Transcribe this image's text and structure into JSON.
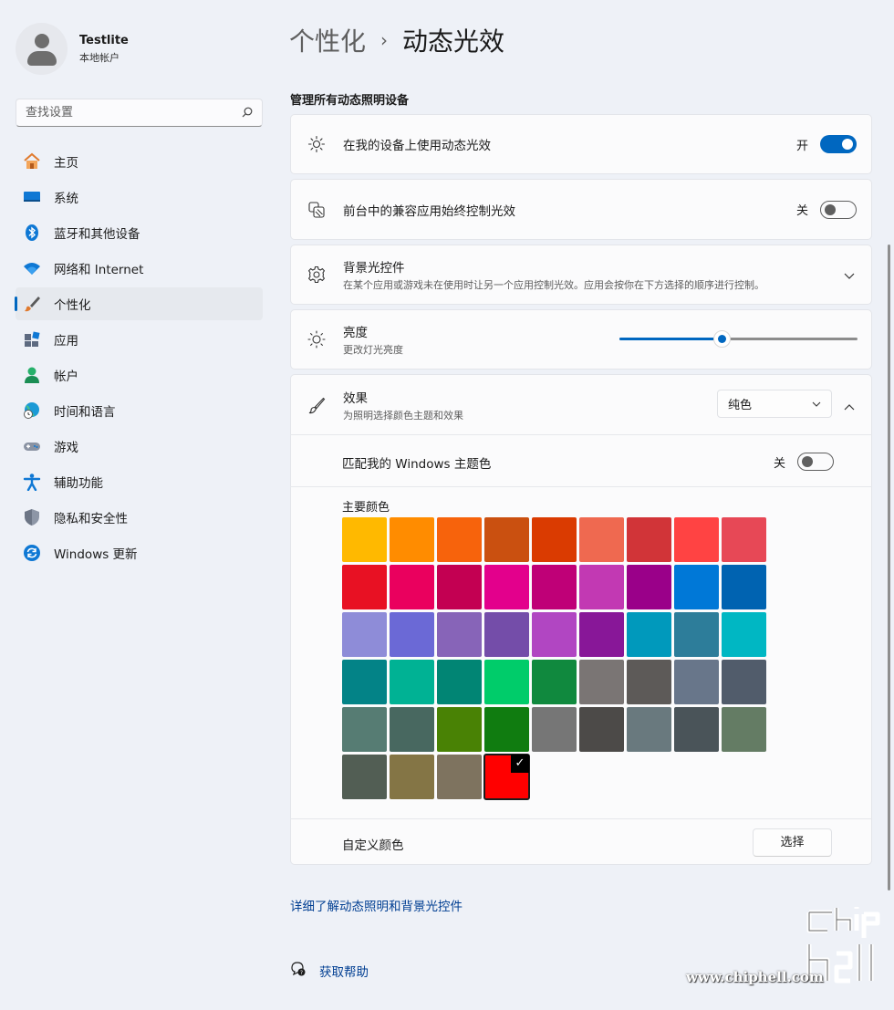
{
  "user": {
    "name": "Testlite",
    "account_type": "本地帐户"
  },
  "search": {
    "placeholder": "查找设置"
  },
  "nav": [
    {
      "label": "主页",
      "icon": "home-icon"
    },
    {
      "label": "系统",
      "icon": "system-icon"
    },
    {
      "label": "蓝牙和其他设备",
      "icon": "bluetooth-icon"
    },
    {
      "label": "网络和 Internet",
      "icon": "wifi-icon"
    },
    {
      "label": "个性化",
      "icon": "brush-icon",
      "active": true
    },
    {
      "label": "应用",
      "icon": "apps-icon"
    },
    {
      "label": "帐户",
      "icon": "account-icon"
    },
    {
      "label": "时间和语言",
      "icon": "globe-clock-icon"
    },
    {
      "label": "游戏",
      "icon": "gamepad-icon"
    },
    {
      "label": "辅助功能",
      "icon": "accessibility-icon"
    },
    {
      "label": "隐私和安全性",
      "icon": "shield-icon"
    },
    {
      "label": "Windows 更新",
      "icon": "update-icon"
    }
  ],
  "breadcrumb": {
    "parent": "个性化",
    "separator": "›",
    "current": "动态光效"
  },
  "section_title": "管理所有动态照明设备",
  "settings": {
    "use_dynamic": {
      "title": "在我的设备上使用动态光效",
      "state_label": "开",
      "on": true
    },
    "foreground": {
      "title": "前台中的兼容应用始终控制光效",
      "state_label": "关",
      "on": false
    },
    "background": {
      "title": "背景光控件",
      "subtitle": "在某个应用或游戏未在使用时让另一个应用控制光效。应用会按你在下方选择的顺序进行控制。"
    },
    "brightness": {
      "title": "亮度",
      "subtitle": "更改灯光亮度",
      "value_percent": 43
    },
    "effects": {
      "title": "效果",
      "subtitle": "为照明选择颜色主题和效果",
      "selected": "纯色"
    },
    "match_theme": {
      "title": "匹配我的 Windows 主题色",
      "state_label": "关",
      "on": false
    },
    "primary_colors_label": "主要颜色",
    "custom_color": {
      "title": "自定义颜色",
      "button": "选择"
    }
  },
  "colors": [
    "#ffb900",
    "#ff8c00",
    "#f7630c",
    "#ca5010",
    "#da3b01",
    "#ef6950",
    "#d13438",
    "#ff4343",
    "#e74856",
    "#e81123",
    "#ea005e",
    "#c30052",
    "#e3008c",
    "#bf0077",
    "#c239b3",
    "#9a0089",
    "#0078d7",
    "#0063b1",
    "#8e8cd8",
    "#6b69d6",
    "#8764b8",
    "#744da9",
    "#b146c2",
    "#881798",
    "#0099bc",
    "#2d7d9a",
    "#00b7c3",
    "#038387",
    "#00b294",
    "#018574",
    "#00cc6a",
    "#10893e",
    "#7a7574",
    "#5d5a58",
    "#68768a",
    "#515c6b",
    "#567c73",
    "#486860",
    "#498205",
    "#107c10",
    "#767676",
    "#4c4a48",
    "#69797e",
    "#4a5459",
    "#647c64",
    "#525e54",
    "#847545",
    "#7e735f",
    "#ff0000"
  ],
  "selected_color_index": 48,
  "links": {
    "learn_more": "详细了解动态照明和背景光控件",
    "get_help": "获取帮助"
  },
  "watermark": {
    "text": "www.chiphell.com"
  }
}
